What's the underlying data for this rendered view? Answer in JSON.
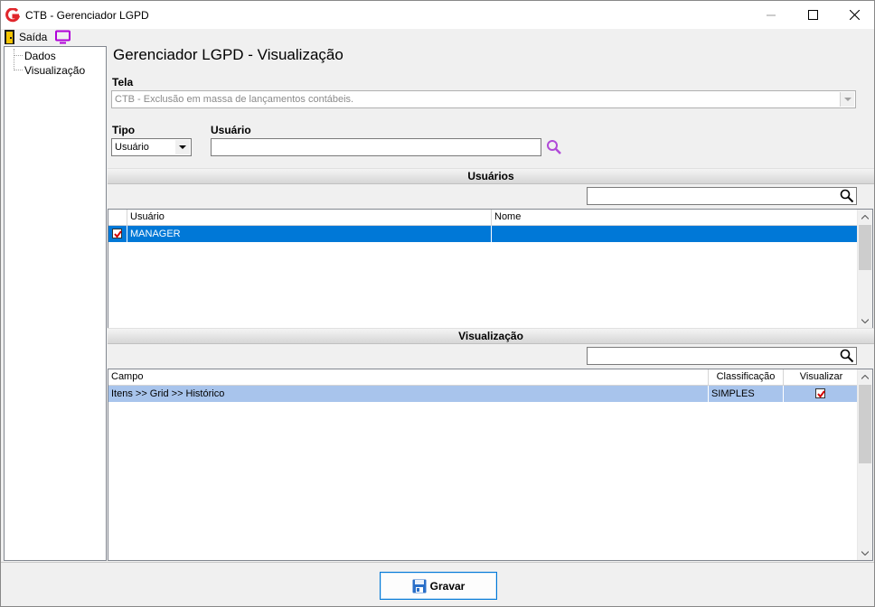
{
  "window": {
    "title": "CTB - Gerenciador LGPD"
  },
  "toolbar": {
    "exit_label": "Saída"
  },
  "tree": {
    "items": [
      "Dados",
      "Visualização"
    ]
  },
  "page": {
    "title": "Gerenciador LGPD - Visualização"
  },
  "form": {
    "tela_label": "Tela",
    "tela_value": "CTB - Exclusão em massa de lançamentos contábeis.",
    "tipo_label": "Tipo",
    "tipo_value": "Usuário",
    "usuario_label": "Usuário",
    "usuario_value": ""
  },
  "usuarios": {
    "section_title": "Usuários",
    "columns": [
      "Usuário",
      "Nome"
    ],
    "rows": [
      {
        "checked": true,
        "usuario": "MANAGER",
        "nome": ""
      }
    ]
  },
  "visualizacao": {
    "section_title": "Visualização",
    "columns": [
      "Campo",
      "Classificação",
      "Visualizar"
    ],
    "rows": [
      {
        "campo": "Itens >> Grid >> Histórico",
        "classificacao": "SIMPLES",
        "visualizar": true
      }
    ]
  },
  "footer": {
    "save_label": "Gravar"
  },
  "colors": {
    "selection": "#0078d7",
    "selected_row_alt": "#a8c4ec",
    "accent_purple": "#b04ad8",
    "check_red": "#d40000"
  }
}
